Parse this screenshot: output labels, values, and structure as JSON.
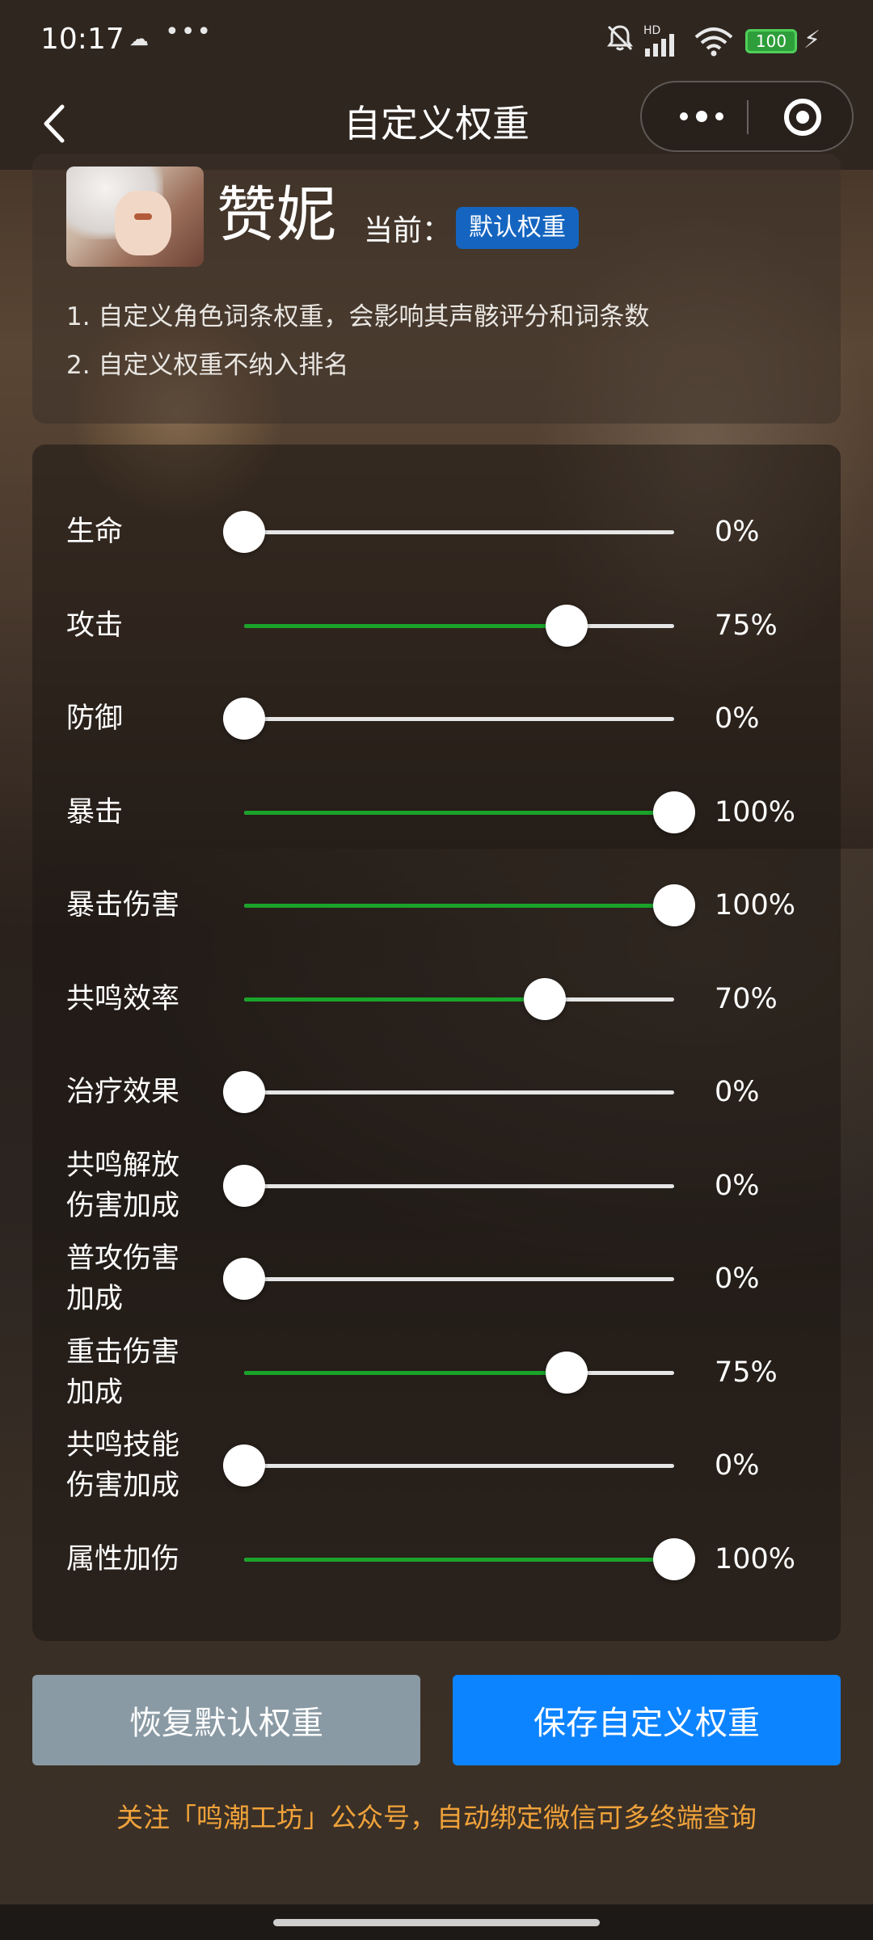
{
  "status_bar": {
    "time": "10:17",
    "battery": "100",
    "icons": [
      "cloud-icon",
      "more-icon",
      "silent-bell-icon",
      "signal-icon",
      "wifi-icon",
      "battery-icon",
      "charging-icon"
    ],
    "hd_label": "HD"
  },
  "nav": {
    "title": "自定义权重",
    "back_icon": "chevron-left-icon"
  },
  "header": {
    "character_name": "赞妮",
    "current_label": "当前：",
    "weight_badge": "默认权重",
    "notes": [
      "1. 自定义角色词条权重，会影响其声骸评分和词条数",
      "2. 自定义权重不纳入排名"
    ]
  },
  "sliders": [
    {
      "label": "生命",
      "value": 0,
      "display": "0%"
    },
    {
      "label": "攻击",
      "value": 75,
      "display": "75%"
    },
    {
      "label": "防御",
      "value": 0,
      "display": "0%"
    },
    {
      "label": "暴击",
      "value": 100,
      "display": "100%"
    },
    {
      "label": "暴击伤害",
      "value": 100,
      "display": "100%"
    },
    {
      "label": "共鸣效率",
      "value": 70,
      "display": "70%"
    },
    {
      "label": "治疗效果",
      "value": 0,
      "display": "0%"
    },
    {
      "label": "共鸣解放\n伤害加成",
      "value": 0,
      "display": "0%"
    },
    {
      "label": "普攻伤害\n加成",
      "value": 0,
      "display": "0%"
    },
    {
      "label": "重击伤害\n加成",
      "value": 75,
      "display": "75%"
    },
    {
      "label": "共鸣技能\n伤害加成",
      "value": 0,
      "display": "0%"
    },
    {
      "label": "属性加伤",
      "value": 100,
      "display": "100%"
    }
  ],
  "buttons": {
    "reset": "恢复默认权重",
    "save": "保存自定义权重"
  },
  "footer_tip": "关注「鸣潮工坊」公众号，自动绑定微信可多终端查询",
  "colors": {
    "accent": "#0d84ff",
    "slider_fill": "#1aa32a",
    "badge": "#1565c0",
    "tip": "#f0a23a",
    "reset_button": "#8a9aa4"
  }
}
